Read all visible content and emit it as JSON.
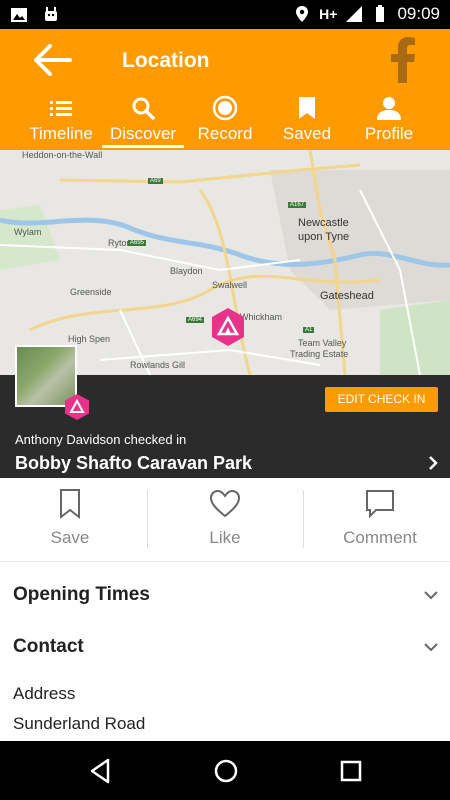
{
  "status_bar": {
    "network": "H+",
    "time": "09:09"
  },
  "app_bar": {
    "title": "Location",
    "tabs": [
      {
        "label": "Timeline",
        "icon": "list-icon"
      },
      {
        "label": "Discover",
        "icon": "search-icon",
        "active": true
      },
      {
        "label": "Record",
        "icon": "record-icon"
      },
      {
        "label": "Saved",
        "icon": "bookmark-icon"
      },
      {
        "label": "Profile",
        "icon": "person-icon"
      }
    ]
  },
  "map": {
    "labels": [
      "Heddon-on-the-Wall",
      "Newcastle",
      "upon Tyne",
      "Wylam",
      "Ryton",
      "Blaydon",
      "Swalwell",
      "Gateshead",
      "Greenside",
      "High Spen",
      "Rowlands Gill",
      "Team Valley",
      "Trading Estate",
      "Whickham"
    ],
    "road_numbers": [
      "A69",
      "A167",
      "A695",
      "A694",
      "A1"
    ]
  },
  "checkin": {
    "edit_label": "EDIT CHECK IN",
    "checked_by": "Anthony Davidson checked in",
    "place_name": "Bobby Shafto Caravan Park"
  },
  "actions": {
    "save_label": "Save",
    "like_label": "Like",
    "comment_label": "Comment"
  },
  "sections": {
    "opening_times": "Opening Times",
    "contact": "Contact",
    "address_label": "Address",
    "address_line1": "Sunderland Road"
  },
  "colors": {
    "accent": "#ff9a00",
    "banner": "#2b2b2b",
    "pin": "#e8338a"
  }
}
